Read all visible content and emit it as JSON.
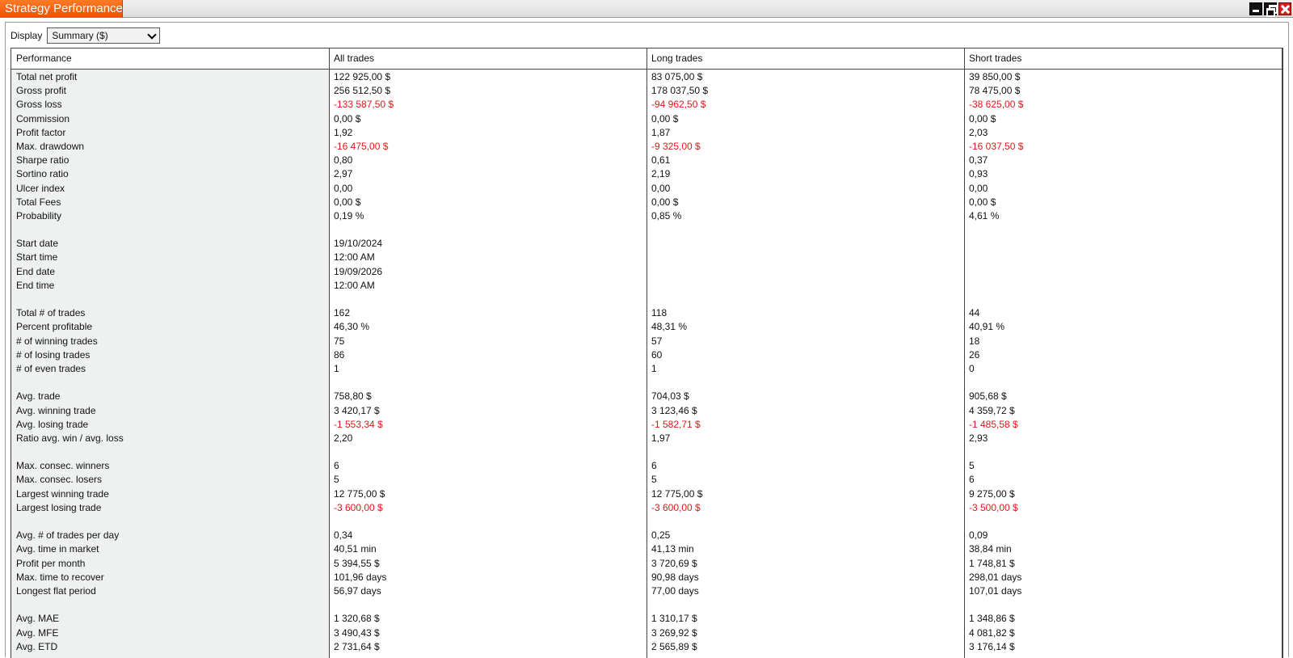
{
  "window": {
    "title": "Strategy Performance"
  },
  "display": {
    "label": "Display",
    "selected": "Summary ($)"
  },
  "columns": [
    "Performance",
    "All trades",
    "Long trades",
    "Short trades"
  ],
  "colors": {
    "negative": "#e01818",
    "title_tab": "#f06010",
    "label_column_bg": "#eff1f1"
  },
  "rows": [
    {
      "label": "Total net profit",
      "values": [
        "122 925,00 $",
        "83 075,00 $",
        "39 850,00 $"
      ]
    },
    {
      "label": "Gross profit",
      "values": [
        "256 512,50 $",
        "178 037,50 $",
        "78 475,00 $"
      ]
    },
    {
      "label": "Gross loss",
      "values": [
        "-133 587,50 $",
        "-94 962,50 $",
        "-38 625,00 $"
      ],
      "negative": true
    },
    {
      "label": "Commission",
      "values": [
        "0,00 $",
        "0,00 $",
        "0,00 $"
      ]
    },
    {
      "label": "Profit factor",
      "values": [
        "1,92",
        "1,87",
        "2,03"
      ]
    },
    {
      "label": "Max. drawdown",
      "values": [
        "-16 475,00 $",
        "-9 325,00 $",
        "-16 037,50 $"
      ],
      "negative": true
    },
    {
      "label": "Sharpe ratio",
      "values": [
        "0,80",
        "0,61",
        "0,37"
      ]
    },
    {
      "label": "Sortino ratio",
      "values": [
        "2,97",
        "2,19",
        "0,93"
      ]
    },
    {
      "label": "Ulcer index",
      "values": [
        "0,00",
        "0,00",
        "0,00"
      ]
    },
    {
      "label": "Total Fees",
      "values": [
        "0,00 $",
        "0,00 $",
        "0,00 $"
      ]
    },
    {
      "label": "Probability",
      "values": [
        "0,19 %",
        "0,85 %",
        "4,61 %"
      ]
    },
    {
      "label": "",
      "values": [
        "",
        "",
        ""
      ]
    },
    {
      "label": "Start date",
      "values": [
        "19/10/2024",
        "",
        ""
      ]
    },
    {
      "label": "Start time",
      "values": [
        "12:00 AM",
        "",
        ""
      ]
    },
    {
      "label": "End date",
      "values": [
        "19/09/2026",
        "",
        ""
      ]
    },
    {
      "label": "End time",
      "values": [
        "12:00 AM",
        "",
        ""
      ]
    },
    {
      "label": "",
      "values": [
        "",
        "",
        ""
      ]
    },
    {
      "label": "Total # of trades",
      "values": [
        "162",
        "118",
        "44"
      ]
    },
    {
      "label": "Percent profitable",
      "values": [
        "46,30 %",
        "48,31 %",
        "40,91 %"
      ]
    },
    {
      "label": "# of winning trades",
      "values": [
        "75",
        "57",
        "18"
      ]
    },
    {
      "label": "# of losing trades",
      "values": [
        "86",
        "60",
        "26"
      ]
    },
    {
      "label": "# of even trades",
      "values": [
        "1",
        "1",
        "0"
      ]
    },
    {
      "label": "",
      "values": [
        "",
        "",
        ""
      ]
    },
    {
      "label": "Avg. trade",
      "values": [
        "758,80 $",
        "704,03 $",
        "905,68 $"
      ]
    },
    {
      "label": "Avg. winning trade",
      "values": [
        "3 420,17 $",
        "3 123,46 $",
        "4 359,72 $"
      ]
    },
    {
      "label": "Avg. losing trade",
      "values": [
        "-1 553,34 $",
        "-1 582,71 $",
        "-1 485,58 $"
      ],
      "negative": true
    },
    {
      "label": "Ratio avg. win / avg. loss",
      "values": [
        "2,20",
        "1,97",
        "2,93"
      ]
    },
    {
      "label": "",
      "values": [
        "",
        "",
        ""
      ]
    },
    {
      "label": "Max. consec. winners",
      "values": [
        "6",
        "6",
        "5"
      ]
    },
    {
      "label": "Max. consec. losers",
      "values": [
        "5",
        "5",
        "6"
      ]
    },
    {
      "label": "Largest winning trade",
      "values": [
        "12 775,00 $",
        "12 775,00 $",
        "9 275,00 $"
      ]
    },
    {
      "label": "Largest losing trade",
      "values": [
        "-3 600,00 $",
        "-3 600,00 $",
        "-3 500,00 $"
      ],
      "negative": true
    },
    {
      "label": "",
      "values": [
        "",
        "",
        ""
      ]
    },
    {
      "label": "Avg. # of trades per day",
      "values": [
        "0,34",
        "0,25",
        "0,09"
      ]
    },
    {
      "label": "Avg. time in market",
      "values": [
        "40,51 min",
        "41,13 min",
        "38,84 min"
      ]
    },
    {
      "label": "Profit per month",
      "values": [
        "5 394,55 $",
        "3 720,69 $",
        "1 748,81 $"
      ]
    },
    {
      "label": "Max. time to recover",
      "values": [
        "101,96 days",
        "90,98 days",
        "298,01 days"
      ]
    },
    {
      "label": "Longest flat period",
      "values": [
        "56,97 days",
        "77,00 days",
        "107,01 days"
      ]
    },
    {
      "label": "",
      "values": [
        "",
        "",
        ""
      ]
    },
    {
      "label": "Avg. MAE",
      "values": [
        "1 320,68 $",
        "1 310,17 $",
        "1 348,86 $"
      ]
    },
    {
      "label": "Avg. MFE",
      "values": [
        "3 490,43 $",
        "3 269,92 $",
        "4 081,82 $"
      ]
    },
    {
      "label": "Avg. ETD",
      "values": [
        "2 731,64 $",
        "2 565,89 $",
        "3 176,14 $"
      ]
    }
  ]
}
